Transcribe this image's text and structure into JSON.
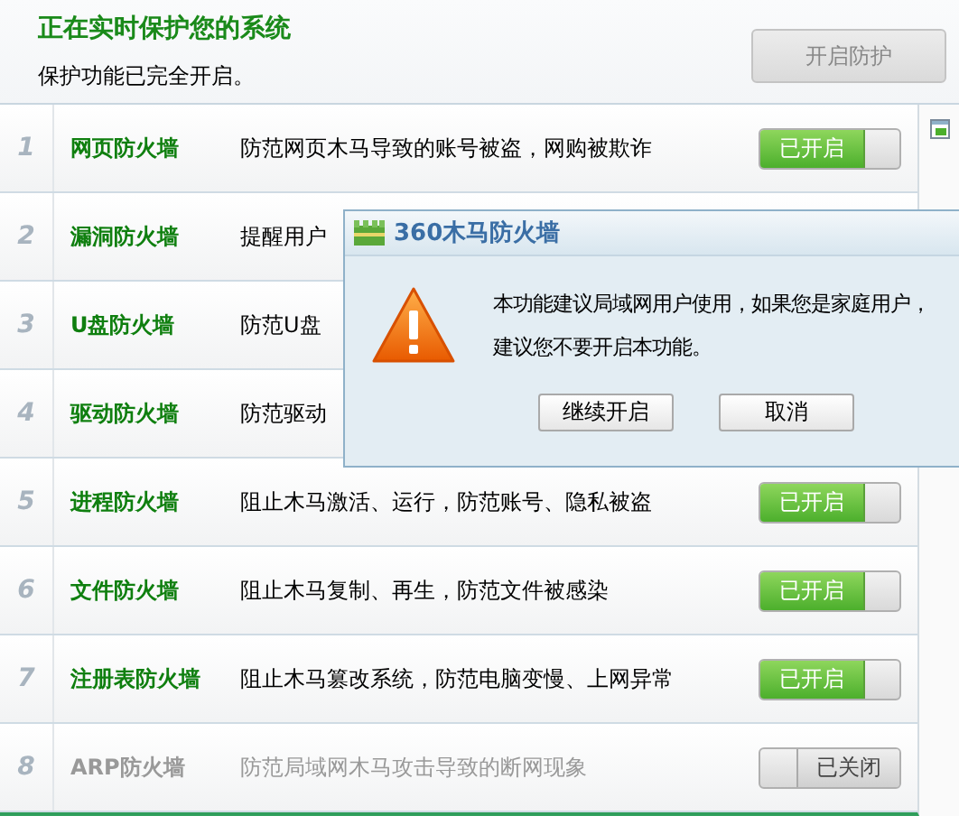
{
  "header": {
    "title": "正在实时保护您的系统",
    "subtitle": "保护功能已完全开启。",
    "button": {
      "label": "开启防护",
      "disabled": true
    }
  },
  "rows": [
    {
      "number": "1",
      "name": "网页防火墙",
      "description": "防范网页木马导致的账号被盗，网购被欺诈",
      "on": true,
      "toggle_label": "已开启"
    },
    {
      "number": "2",
      "name": "漏洞防火墙",
      "description": "提醒用户"
    },
    {
      "number": "3",
      "name": "U盘防火墙",
      "description": "防范U盘"
    },
    {
      "number": "4",
      "name": "驱动防火墙",
      "description": "防范驱动"
    },
    {
      "number": "5",
      "name": "进程防火墙",
      "description": "阻止木马激活、运行，防范账号、隐私被盗",
      "on": true,
      "toggle_label": "已开启"
    },
    {
      "number": "6",
      "name": "文件防火墙",
      "description": "阻止木马复制、再生，防范文件被感染",
      "on": true,
      "toggle_label": "已开启"
    },
    {
      "number": "7",
      "name": "注册表防火墙",
      "description": "阻止木马篡改系统，防范电脑变慢、上网异常",
      "on": true,
      "toggle_label": "已开启"
    },
    {
      "number": "8",
      "name": "ARP防火墙",
      "description": "防范局域网木马攻击导致的断网现象",
      "on": false,
      "toggle_label": "已关闭"
    }
  ],
  "dialog": {
    "title": "360木马防火墙",
    "message": [
      "本功能建议局域网用户使用，如果您是家庭用户，",
      "建议您不要开启本功能。"
    ],
    "buttons": [
      "继续开启",
      "取消"
    ]
  }
}
